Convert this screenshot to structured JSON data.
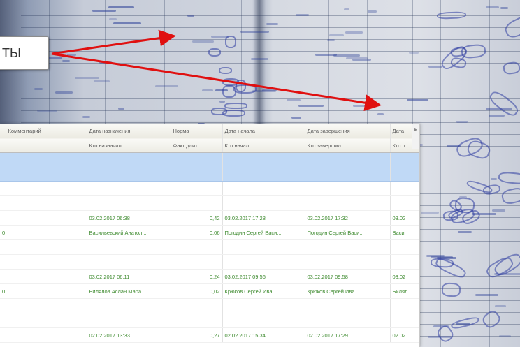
{
  "callout": {
    "text": "ТЫ"
  },
  "colors": {
    "arrow": "#e01010",
    "selected_row": "#c0d9f6",
    "cell_text": "#3d8a2e"
  },
  "grid": {
    "columns": [
      {
        "top": "",
        "bottom": ""
      },
      {
        "top": "Комментарий",
        "bottom": ""
      },
      {
        "top": "Дата назначения",
        "bottom": "Кто назначил"
      },
      {
        "top": "Норма",
        "bottom": "Факт длит."
      },
      {
        "top": "Дата начала",
        "bottom": "Кто начал"
      },
      {
        "top": "Дата завершения",
        "bottom": "Кто завершил"
      },
      {
        "top": "Дата",
        "bottom": "Кто п"
      }
    ],
    "rows": [
      {
        "type": "selected",
        "cells": [
          "",
          "",
          "",
          "",
          "",
          "",
          ""
        ]
      },
      {
        "type": "selected2",
        "cells": [
          "",
          "",
          "",
          "",
          "",
          "",
          ""
        ]
      },
      {
        "type": "blank",
        "cells": [
          "",
          "",
          "",
          "",
          "",
          "",
          ""
        ]
      },
      {
        "type": "blank",
        "cells": [
          "",
          "",
          "",
          "",
          "",
          "",
          ""
        ]
      },
      {
        "type": "data",
        "cells": [
          "",
          "",
          "03.02.2017 06:38",
          "0,42",
          "03.02.2017 17:28",
          "03.02.2017 17:32",
          "03.02"
        ]
      },
      {
        "type": "data",
        "cells": [
          "0",
          "",
          "Васильевский Анатол...",
          "0,06",
          "Погодин Сергей Васи...",
          "Погодин Сергей Васи...",
          "Васи"
        ]
      },
      {
        "type": "blank",
        "cells": [
          "",
          "",
          "",
          "",
          "",
          "",
          ""
        ]
      },
      {
        "type": "blank",
        "cells": [
          "",
          "",
          "",
          "",
          "",
          "",
          ""
        ]
      },
      {
        "type": "data",
        "cells": [
          "",
          "",
          "03.02.2017 06:11",
          "0,24",
          "03.02.2017 09:56",
          "03.02.2017 09:58",
          "03.02"
        ]
      },
      {
        "type": "data",
        "cells": [
          "0",
          "",
          "Билялов Аслан Мара...",
          "0,02",
          "Крюков Сергей Ива...",
          "Крюков Сергей Ива...",
          "Билял"
        ]
      },
      {
        "type": "blank",
        "cells": [
          "",
          "",
          "",
          "",
          "",
          "",
          ""
        ]
      },
      {
        "type": "blank",
        "cells": [
          "",
          "",
          "",
          "",
          "",
          "",
          ""
        ]
      },
      {
        "type": "data",
        "cells": [
          "",
          "",
          "02.02.2017 13:33",
          "0,27",
          "02.02.2017 15:34",
          "02.02.2017 17:29",
          "02.02"
        ]
      }
    ],
    "scroll_glyph": "▸"
  }
}
